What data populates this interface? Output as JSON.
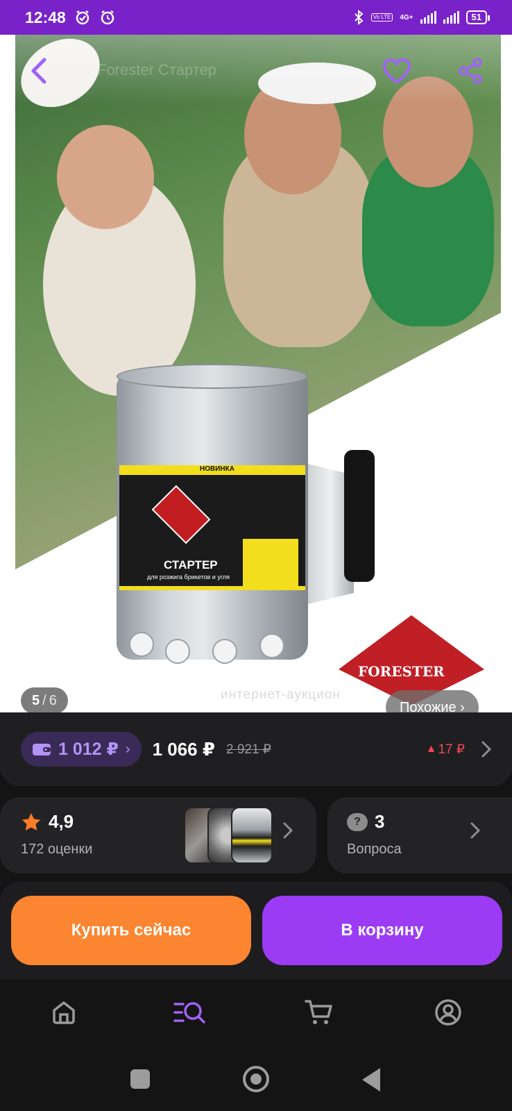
{
  "status_bar": {
    "time": "12:48",
    "network": "4G+",
    "volte": "Vo LTE",
    "battery": "51"
  },
  "gallery": {
    "ghost_title": "Forester Стартер",
    "current": "5",
    "separator": "/",
    "total": "6",
    "similar_label": "Похожие ›",
    "brand_badge": "FORESTER",
    "watermark": "интернет-аукцион",
    "product_label": {
      "badge_new": "НОВИНКА",
      "title": "СТАРТЕР",
      "subtitle": "для розжига брикетов и угля"
    }
  },
  "price": {
    "wallet_price": "1 012 ₽",
    "wallet_chevron": "›",
    "current": "1 066 ₽",
    "old": "2 921 ₽",
    "delta": "17 ₽",
    "delta_arrow": "▲"
  },
  "rating": {
    "score": "4,9",
    "count_label": "172 оценки"
  },
  "questions": {
    "count": "3",
    "label": "Вопроса",
    "icon_glyph": "?"
  },
  "actions": {
    "buy_now": "Купить сейчас",
    "add_to_cart": "В корзину"
  },
  "colors": {
    "status_bar": "#7a22c9",
    "accent_purple": "#9b3cf4",
    "accent_orange": "#fb8530",
    "wallet_text": "#b593f5",
    "price_up": "#f0455a",
    "active_tab": "#a162f7"
  },
  "tabs": [
    {
      "icon": "home-icon",
      "active": false
    },
    {
      "icon": "catalog-search-icon",
      "active": true
    },
    {
      "icon": "cart-icon",
      "active": false
    },
    {
      "icon": "profile-icon",
      "active": false
    }
  ]
}
